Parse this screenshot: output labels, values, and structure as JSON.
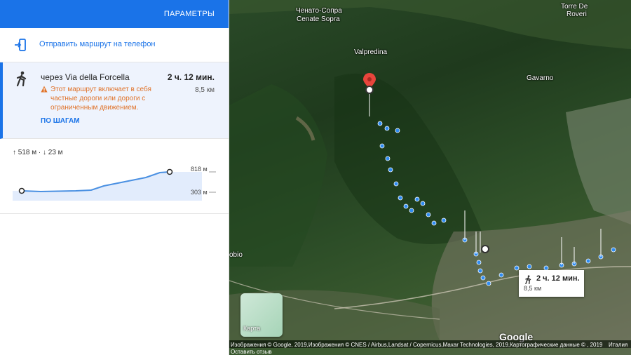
{
  "panel": {
    "params_label": "ПАРАМЕТРЫ",
    "send_label": "Отправить маршрут на телефон",
    "route": {
      "title": "через Via della Forcella",
      "time": "2 ч. 12 мин.",
      "distance": "8,5 км",
      "warning": "Этот маршрут включает в себя частные дороги или дороги с ограниченным движением.",
      "steps_label": "ПО ШАГАМ"
    },
    "elevation": {
      "stats": "↑ 518 м · ↓ 23 м",
      "max_label": "818 м",
      "min_label": "303 м"
    }
  },
  "map": {
    "places": {
      "p1": "Ченато-Сопра",
      "p2": "Cenate Sopra",
      "p3": "Valpredina",
      "p4": "Gavarno",
      "p5": "Torre De",
      "p6": "Roveri",
      "p7": "obio"
    },
    "thumbnail_label": "Карта",
    "route_box": {
      "time": "2 ч. 12 мин.",
      "distance": "8,5 км"
    },
    "google_logo": "Google",
    "attribution": "Изображения © Google, 2019,Изображения © CNES / Airbus,Landsat / Copernicus,Maxar Technologies, 2019,Картографические данные © , 2019",
    "country": "Италия",
    "feedback": "Оставить отзыв"
  },
  "colors": {
    "accent": "#1a73e8",
    "warning": "#e0732a",
    "route_dots": "#2f8cf2",
    "pin": "#e8453c"
  }
}
